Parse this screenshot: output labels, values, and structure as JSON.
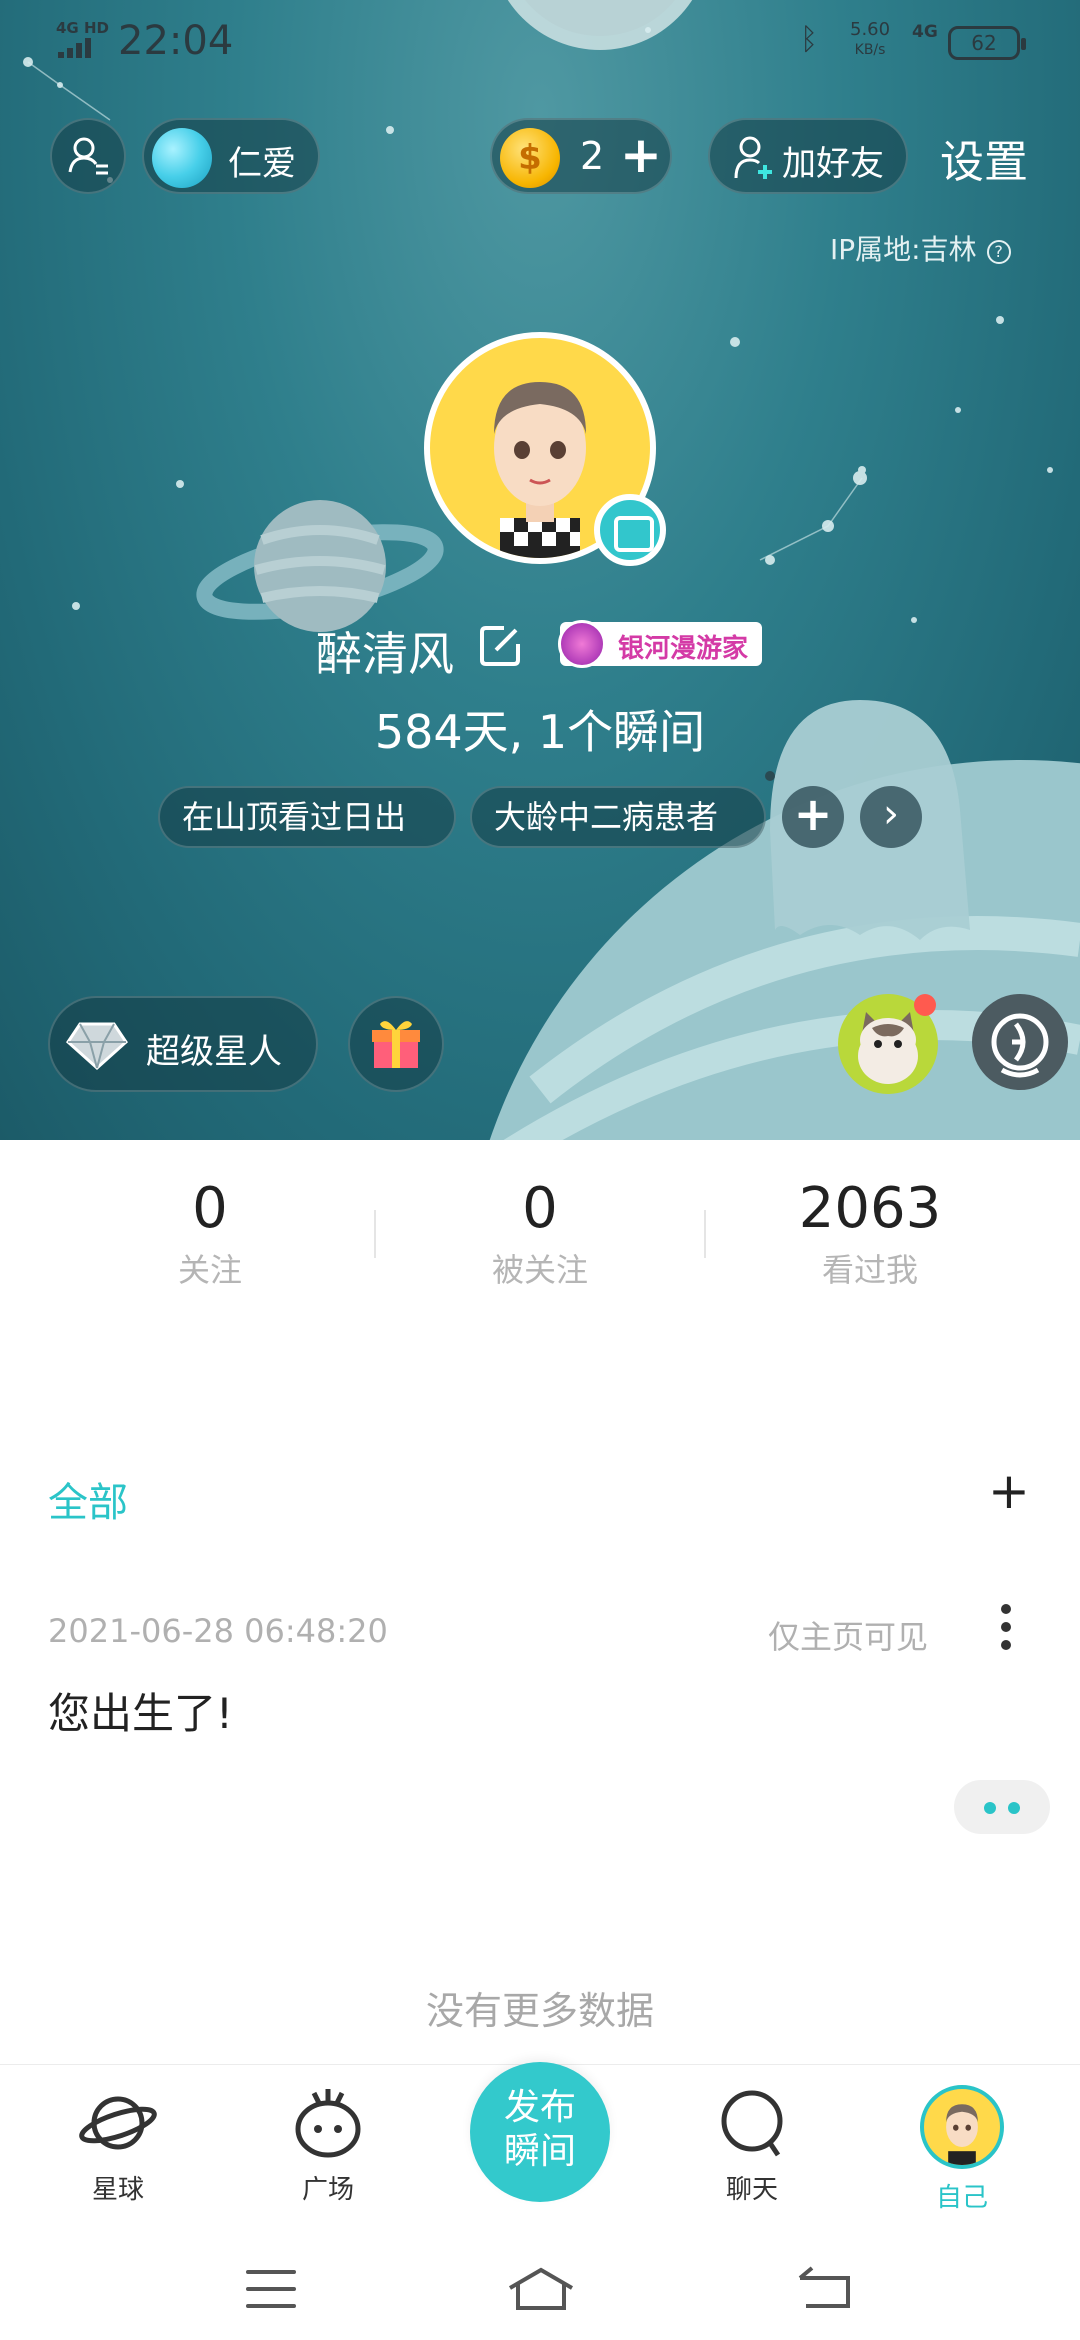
{
  "status_bar": {
    "network": "4G HD",
    "time": "22:04",
    "speed": "5.60",
    "speed_unit": "KB/s",
    "network2": "4G",
    "battery": "62"
  },
  "header": {
    "planet_name": "仁爱",
    "coins": "2",
    "coin_symbol": "$",
    "coin_plus": "+",
    "add_friend": "加好友",
    "settings": "设置",
    "ip_location": "IP属地:吉林"
  },
  "profile": {
    "username": "醉清风",
    "badge": "银河漫游家",
    "stats_line": "584天, 1个瞬间",
    "tags": [
      "在山顶看过日出",
      "大龄中二病患者"
    ],
    "add_tag": "+",
    "more_tags": "›",
    "super_star": "超级星人"
  },
  "counts": [
    {
      "value": "0",
      "label": "关注"
    },
    {
      "value": "0",
      "label": "被关注"
    },
    {
      "value": "2063",
      "label": "看过我"
    }
  ],
  "feed": {
    "filter_label": "全部",
    "add_label": "+",
    "post": {
      "time": "2021-06-28 06:48:20",
      "visibility": "仅主页可见",
      "text": "您出生了!"
    },
    "end_text": "没有更多数据"
  },
  "tabbar": {
    "items": [
      "星球",
      "广场",
      "聊天",
      "自己"
    ],
    "publish": [
      "发布",
      "瞬间"
    ],
    "active": "自己"
  },
  "colors": {
    "accent": "#2ac4c8",
    "hero_bg": "#2f7f8c",
    "badge_text": "#d43aa6"
  },
  "icons": [
    "user-switch-icon",
    "coin-icon",
    "add-friend-icon",
    "help-icon",
    "edit-icon",
    "shop-icon",
    "diamond-icon",
    "gift-icon",
    "voice-icon",
    "more-vertical-icon",
    "comment-icon",
    "planet-icon",
    "square-icon",
    "chat-icon"
  ]
}
